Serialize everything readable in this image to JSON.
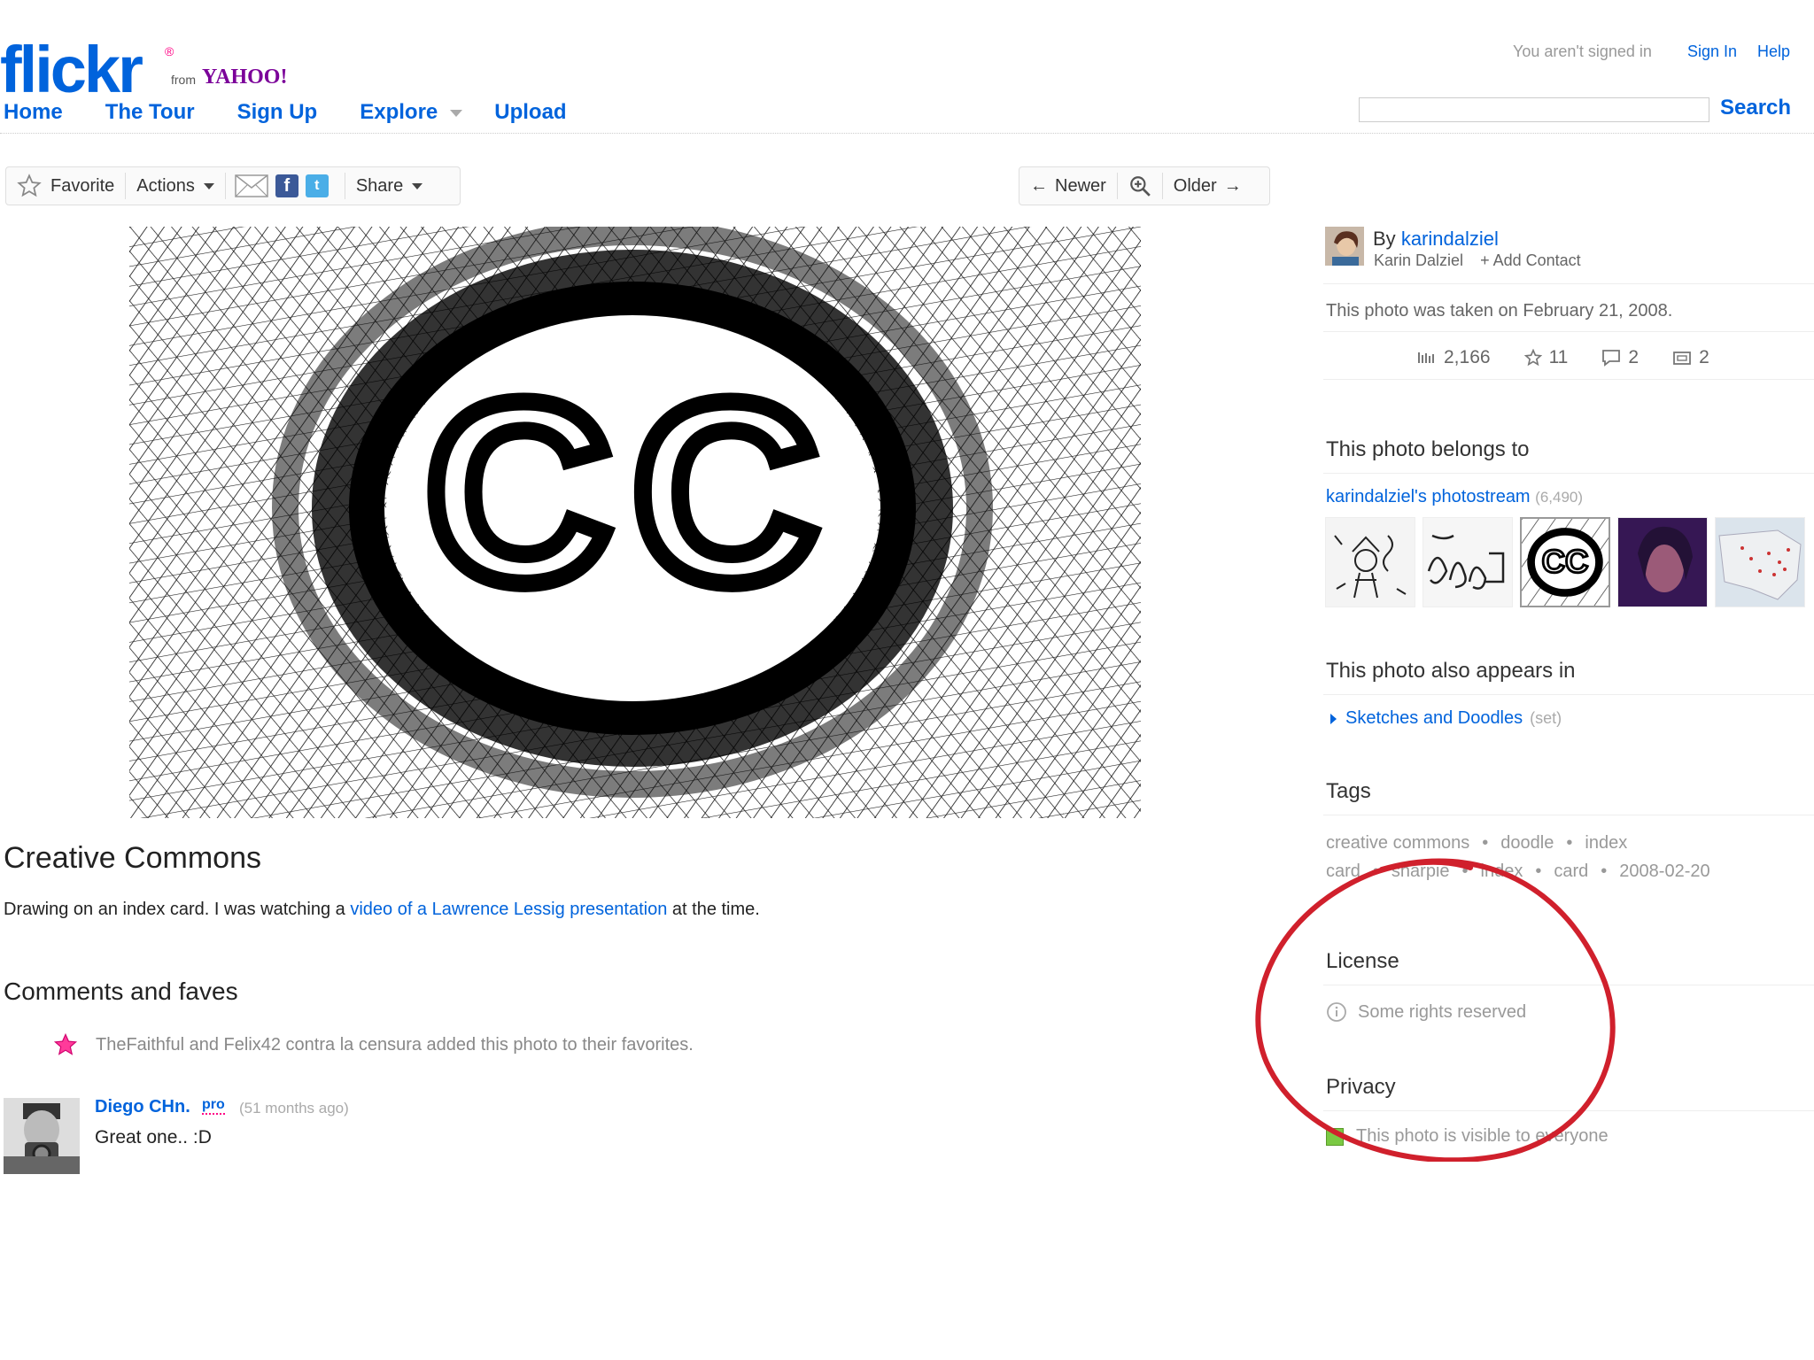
{
  "header": {
    "logo_text": "flickr",
    "logo_from": "from",
    "logo_yahoo": "YAHOO!",
    "signed_in_note": "You aren't signed in",
    "sign_in": "Sign In",
    "help": "Help",
    "search_button": "Search",
    "search_value": "",
    "nav": {
      "home": "Home",
      "tour": "The Tour",
      "signup": "Sign Up",
      "explore": "Explore",
      "upload": "Upload"
    }
  },
  "toolbar": {
    "favorite": "Favorite",
    "actions": "Actions",
    "share": "Share",
    "newer": "Newer",
    "older": "Older"
  },
  "photo": {
    "cc_text": "CC",
    "title": "Creative Commons",
    "description_prefix": "Drawing on an index card. I was watching a ",
    "description_link": "video of a Lawrence Lessig presentation",
    "description_suffix": " at the time."
  },
  "comments": {
    "heading": "Comments and faves",
    "fave_line": "TheFaithful and Felix42 contra la censura added this photo to their favorites.",
    "items": [
      {
        "author": "Diego CHn.",
        "badge": "pro",
        "time": "(51 months ago)",
        "text": "Great one.. :D"
      }
    ]
  },
  "sidebar": {
    "owner_by": "By",
    "owner_username": "karindalziel",
    "owner_realname": "Karin Dalziel",
    "add_contact": "+ Add Contact",
    "taken": "This photo was taken on February 21, 2008.",
    "stats": {
      "views": "2,166",
      "faves": "11",
      "comments": "2",
      "sets": "2"
    },
    "belongs_heading": "This photo belongs to",
    "photostream_link": "karindalziel's photostream",
    "photostream_count": "(6,490)",
    "appears_heading": "This photo also appears in",
    "set_name": "Sketches and Doodles",
    "set_type": "(set)",
    "tags_heading": "Tags",
    "tags": [
      "creative commons",
      "doodle",
      "index card",
      "sharpie",
      "index",
      "card",
      "2008-02-20"
    ],
    "license_heading": "License",
    "license_text": "Some rights reserved",
    "privacy_heading": "Privacy",
    "privacy_text": "This photo is visible to everyone"
  },
  "colors": {
    "link": "#0063dc",
    "accent_pink": "#ff0084",
    "annotation_red": "#d0202c",
    "privacy_green": "#7ac943"
  }
}
